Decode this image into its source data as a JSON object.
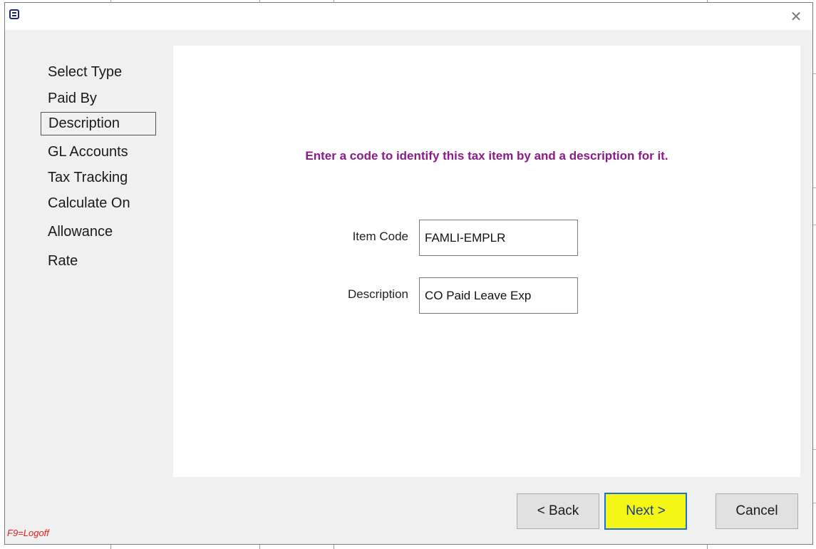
{
  "dialog": {
    "app_icon": "app-logo-icon",
    "close_icon": "close-icon",
    "close_glyph": "✕"
  },
  "steps": [
    {
      "label": "Select Type",
      "active": false
    },
    {
      "label": "Paid By",
      "active": false
    },
    {
      "label": "Description",
      "active": true
    },
    {
      "label": "GL Accounts",
      "active": false
    },
    {
      "label": "Tax Tracking",
      "active": false
    },
    {
      "label": "Calculate On",
      "active": false
    },
    {
      "label": "Allowance",
      "active": false
    },
    {
      "label": "Rate",
      "active": false
    }
  ],
  "panel": {
    "instruction": "Enter a code to identify this tax item by and a description for it.",
    "item_code_label": "Item Code",
    "item_code_value": "FAMLI-EMPLR",
    "description_label": "Description",
    "description_value": "CO Paid Leave Exp"
  },
  "footer": {
    "logoff": "F9=Logoff",
    "back_label": "< Back",
    "next_label": "Next >",
    "cancel_label": "Cancel"
  },
  "colors": {
    "instruction_text": "#8b1a8b",
    "next_highlight": "#f4f716",
    "logoff_text": "#e02020",
    "dialog_bg": "#f0f0f0"
  }
}
